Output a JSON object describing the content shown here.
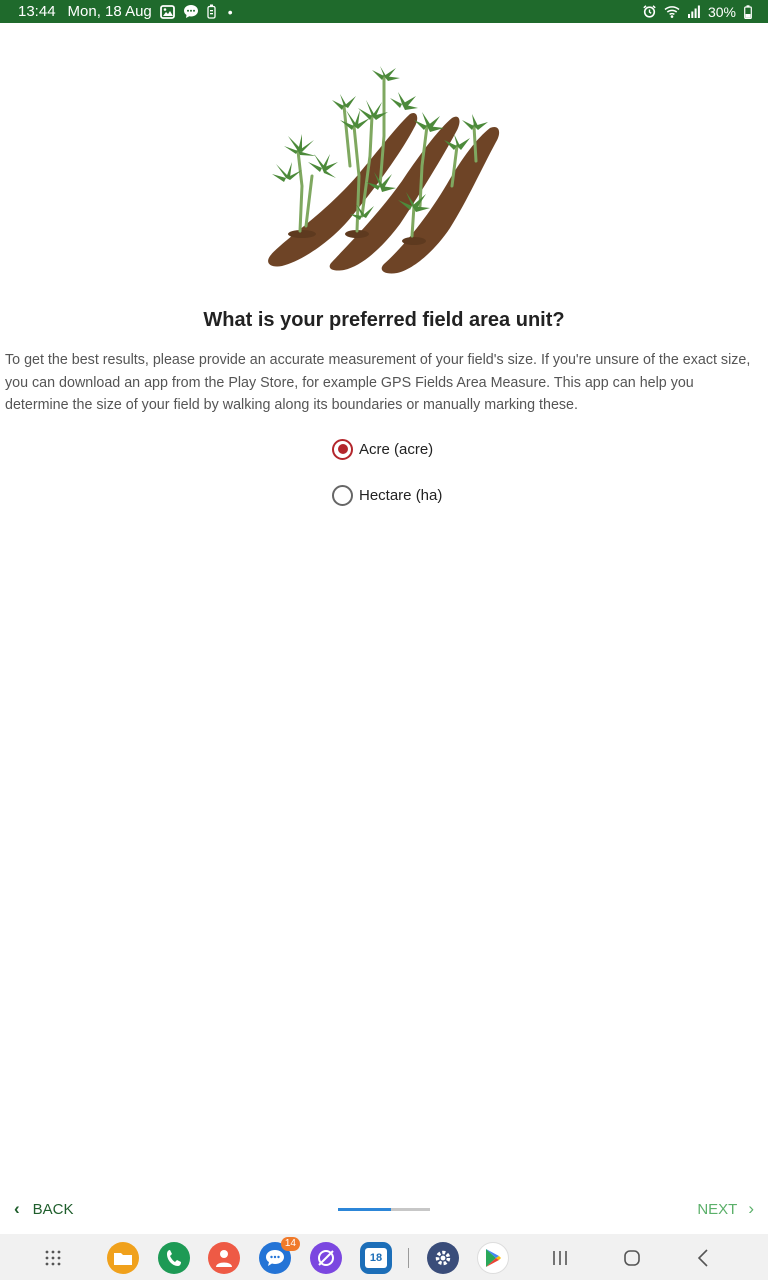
{
  "status_bar": {
    "time": "13:44",
    "date": "Mon, 18 Aug",
    "battery": "30%",
    "bg_color": "#1f6a2c"
  },
  "question": {
    "title": "What is your preferred field area unit?",
    "description": "To get the best results, please provide an accurate measurement of your field's size. If you're unsure of the exact size, you can download an app from the Play Store, for example GPS Fields Area Measure. This app can help you determine the size of your field by walking along its boundaries or manually marking these."
  },
  "options": [
    {
      "label": "Acre (acre)",
      "selected": true
    },
    {
      "label": "Hectare (ha)",
      "selected": false
    }
  ],
  "footer": {
    "back_label": "BACK",
    "next_label": "NEXT",
    "progress_fraction": 0.58
  },
  "nav_bar": {
    "messages_badge": "14",
    "calendar_day": "18",
    "icons": [
      "apps-grid-icon",
      "my-files-icon",
      "phone-icon",
      "contacts-icon",
      "messages-icon",
      "internet-icon",
      "calendar-icon",
      "settings-icon",
      "play-store-icon",
      "recents-icon",
      "home-icon",
      "back-icon"
    ]
  },
  "colors": {
    "radio_selected": "#b3262c",
    "back_text": "#1f5e2c",
    "next_text": "#5bb06a",
    "progress": "#2c86d8"
  }
}
